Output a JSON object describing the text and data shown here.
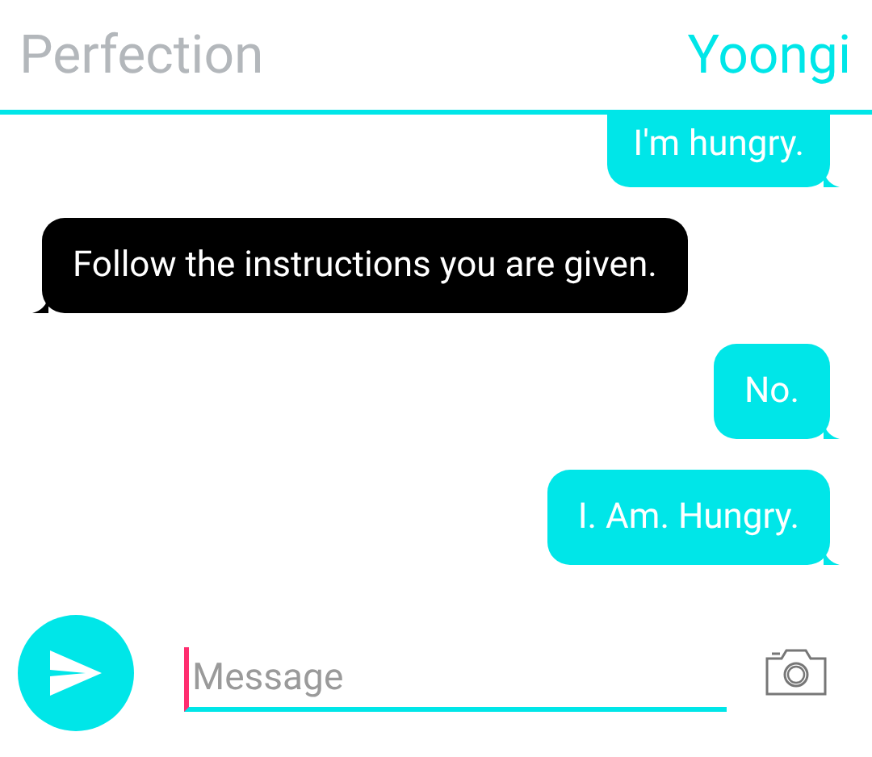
{
  "header": {
    "title": "Perfection",
    "contact": "Yoongi"
  },
  "messages": [
    {
      "kind": "sent",
      "text": "I'm hungry."
    },
    {
      "kind": "received",
      "text": "Follow the instructions you are given."
    },
    {
      "kind": "sent",
      "text": "No."
    },
    {
      "kind": "sent",
      "text": "I. Am. Hungry."
    }
  ],
  "composer": {
    "placeholder": "Message"
  }
}
